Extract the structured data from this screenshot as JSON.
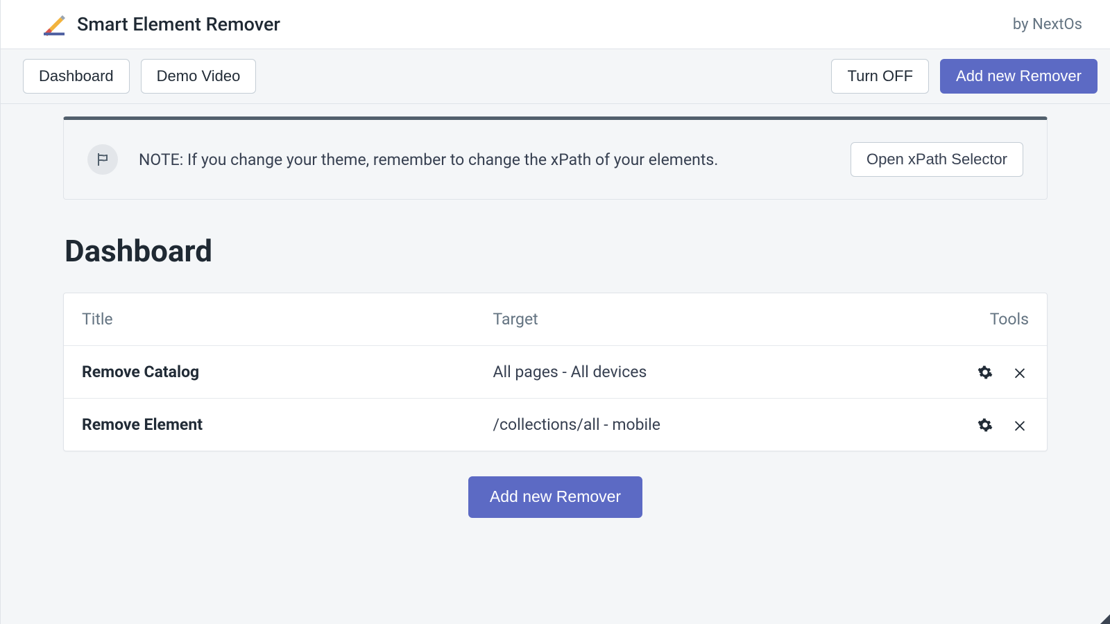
{
  "header": {
    "app_title": "Smart Element Remover",
    "brand": "by NextOs"
  },
  "toolbar": {
    "dashboard": "Dashboard",
    "demo_video": "Demo Video",
    "turn_off": "Turn OFF",
    "add_new": "Add new Remover"
  },
  "banner": {
    "note": "NOTE: If you change your theme, remember to change the xPath of your elements.",
    "open_selector": "Open xPath Selector"
  },
  "page_title": "Dashboard",
  "table": {
    "columns": {
      "title": "Title",
      "target": "Target",
      "tools": "Tools"
    },
    "rows": [
      {
        "title": "Remove Catalog",
        "target": "All pages - All devices"
      },
      {
        "title": "Remove Element",
        "target": "/collections/all - mobile"
      }
    ]
  },
  "cta": {
    "add_new": "Add new Remover"
  },
  "colors": {
    "primary": "#5c6ac4",
    "text": "#212b36",
    "muted": "#637381"
  }
}
